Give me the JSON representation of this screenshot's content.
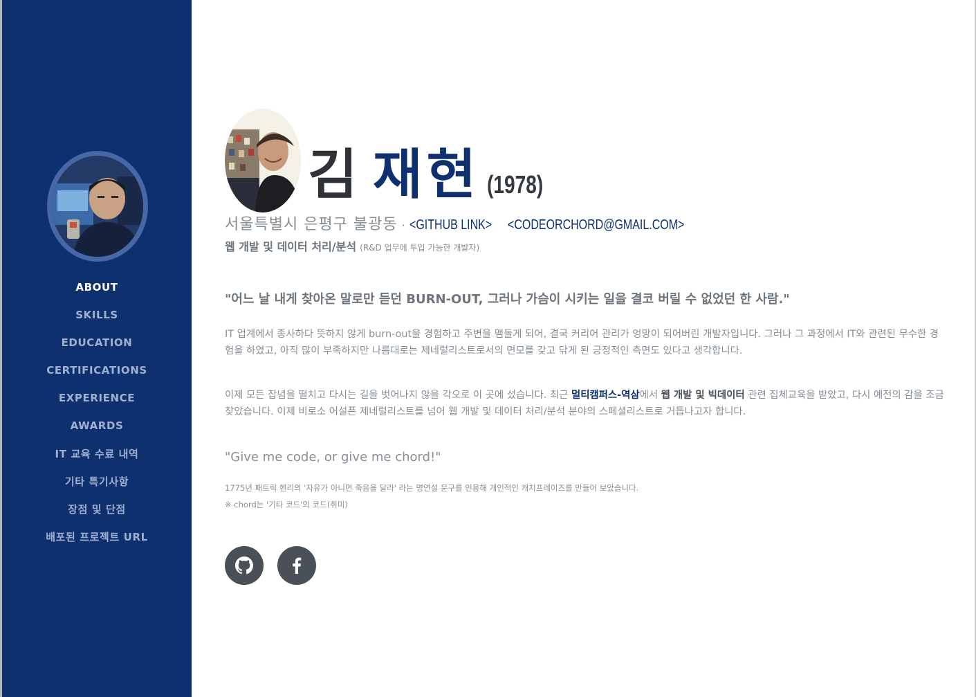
{
  "sidebar": {
    "nav": [
      {
        "label": "ABOUT",
        "active": true
      },
      {
        "label": "SKILLS",
        "active": false
      },
      {
        "label": "EDUCATION",
        "active": false
      },
      {
        "label": "CERTIFICATIONS",
        "active": false
      },
      {
        "label": "EXPERIENCE",
        "active": false
      },
      {
        "label": "AWARDS",
        "active": false
      },
      {
        "label": "IT 교육 수료 내역",
        "active": false
      },
      {
        "label": "기타 특기사항",
        "active": false
      },
      {
        "label": "장점 및 단점",
        "active": false
      },
      {
        "label": "배포된 프로젝트 URL",
        "active": false
      }
    ]
  },
  "header": {
    "first_name": "김",
    "last_name": "재현",
    "birth_year": "(1978)",
    "address": "서울특별시 은평구 불광동",
    "separator": "·",
    "github_link": "<GITHUB LINK>",
    "email": "<CODEORCHORD@GMAIL.COM>",
    "role_main": "웹 개발 및 데이터 처리/분석",
    "role_sub": "(R&D 업무에 투입 가능한 개발자)"
  },
  "about": {
    "quote": "\"어느 날 내게 찾아온 말로만 듣던 BURN-OUT, 그러나 가슴이 시키는 일을 결코 버릴 수 없었던 한 사람.\"",
    "p1": "IT 업계에서 종사하다 뜻하지 않게 burn-out을 경험하고 주변을 맴돌게 되어, 결국 커리어 관리가 엉망이 되어버린 개발자입니다. 그러나 그 과정에서 IT와 관련된 무수한 경험을 하였고, 아직 많이 부족하지만 나름대로는 제네럴리스트로서의 면모를 갖고 닦게 된 긍정적인 측면도 있다고 생각합니다.",
    "p2_a": "이제 모든 잡념을 떨치고 다시는 길을 벗어나지 않을 각오로 이 곳에 섰습니다. 최근 ",
    "p2_accent": "멀티캠퍼스-역삼",
    "p2_b": "에서 ",
    "p2_bold": "웹 개발 및 빅데이터",
    "p2_c": " 관련 집체교육을 받았고, 다시 예전의 감을 조금 찾았습니다. 이제 비로소 어설픈 제네럴리스트를 넘어 웹 개발 및 데이터 처리/분석 분야의 스페셜리스트로 거듭나고자 합니다.",
    "slogan": "\"Give me code, or give me chord!\"",
    "note1": "1775년 패트릭 헨리의 '자유가 아니면 죽음을 달라' 라는 명연설 문구를 인용해 개인적인 캐치프레이즈를 만들어 보았습니다.",
    "note2": "※ chord는 '기타 코드'의 코드(취미)"
  },
  "social": {
    "icons": [
      "github-icon",
      "facebook-icon"
    ]
  },
  "colors": {
    "sidebar_bg": "#0f306f",
    "accent": "#0f306f",
    "text_muted": "#868e96",
    "social_bg": "#495057"
  }
}
